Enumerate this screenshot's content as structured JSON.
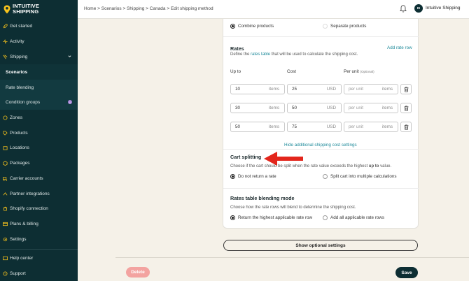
{
  "brand": {
    "name_line1": "INTUITIVE",
    "name_line2": "SHIPPING",
    "accent": "#f6c21c",
    "sidebar_bg": "#0d2e33"
  },
  "sidebar": {
    "items": [
      {
        "label": "Get started",
        "icon": "rocket-icon"
      },
      {
        "label": "Activity",
        "icon": "activity-icon"
      },
      {
        "label": "Shipping",
        "icon": "shipping-icon"
      },
      {
        "label": "Scenarios"
      },
      {
        "label": "Rate blending"
      },
      {
        "label": "Condition groups",
        "badge": "i"
      },
      {
        "label": "Zones",
        "icon": "zones-icon"
      },
      {
        "label": "Products",
        "icon": "products-icon"
      },
      {
        "label": "Locations",
        "icon": "locations-icon"
      },
      {
        "label": "Packages",
        "icon": "packages-icon"
      },
      {
        "label": "Carrier accounts",
        "icon": "carrier-icon"
      },
      {
        "label": "Partner integrations",
        "icon": "partner-icon"
      },
      {
        "label": "Shopify connection",
        "icon": "shopify-icon"
      },
      {
        "label": "Plans & billing",
        "icon": "billing-icon"
      },
      {
        "label": "Settings",
        "icon": "gear-icon"
      },
      {
        "label": "Help center",
        "icon": "help-icon"
      },
      {
        "label": "Support",
        "icon": "support-icon"
      }
    ]
  },
  "topbar": {
    "breadcrumb": "Home > Scenarios > Shipping > Canada > Edit shipping method",
    "avatar_initials": "IS",
    "user_name": "Intuitive Shipping"
  },
  "combine": {
    "option1": "Combine products",
    "option2": "Separate products",
    "selected": "option1"
  },
  "rates": {
    "title": "Rates",
    "desc_prefix": "Define the ",
    "desc_link": "rates table",
    "desc_suffix": " that will be used to calculate the shipping cost.",
    "add_label": "Add rate row",
    "col_upto": "Up to",
    "col_cost": "Cost",
    "col_perunit": "Per unit",
    "col_optional": "(Optional)",
    "rows": [
      {
        "upto": "10",
        "upto_unit": "items",
        "cost": "25",
        "currency": "USD",
        "perunit_ph": "per unit",
        "perunit_unit": "items"
      },
      {
        "upto": "30",
        "upto_unit": "items",
        "cost": "50",
        "currency": "USD",
        "perunit_ph": "per unit",
        "perunit_unit": "items"
      },
      {
        "upto": "50",
        "upto_unit": "items",
        "cost": "75",
        "currency": "USD",
        "perunit_ph": "per unit",
        "perunit_unit": "items"
      }
    ],
    "hide_link": "Hide additional shipping cost settings"
  },
  "cart_splitting": {
    "title": "Cart splitting",
    "desc_prefix": "Choose if the cart should be split when the rate value exceeds the highest ",
    "desc_bold": "up to",
    "desc_suffix": " value.",
    "option1": "Do not return a rate",
    "option2": "Split cart into multiple calculations"
  },
  "blending": {
    "title": "Rates table blending mode",
    "desc": "Choose how the rate rows will blend to determine the shipping cost.",
    "option1": "Return the highest applicable rate row",
    "option2": "Add all applicable rate rows"
  },
  "actions": {
    "show_optional": "Show optional settings",
    "delete": "Delete",
    "save": "Save"
  }
}
